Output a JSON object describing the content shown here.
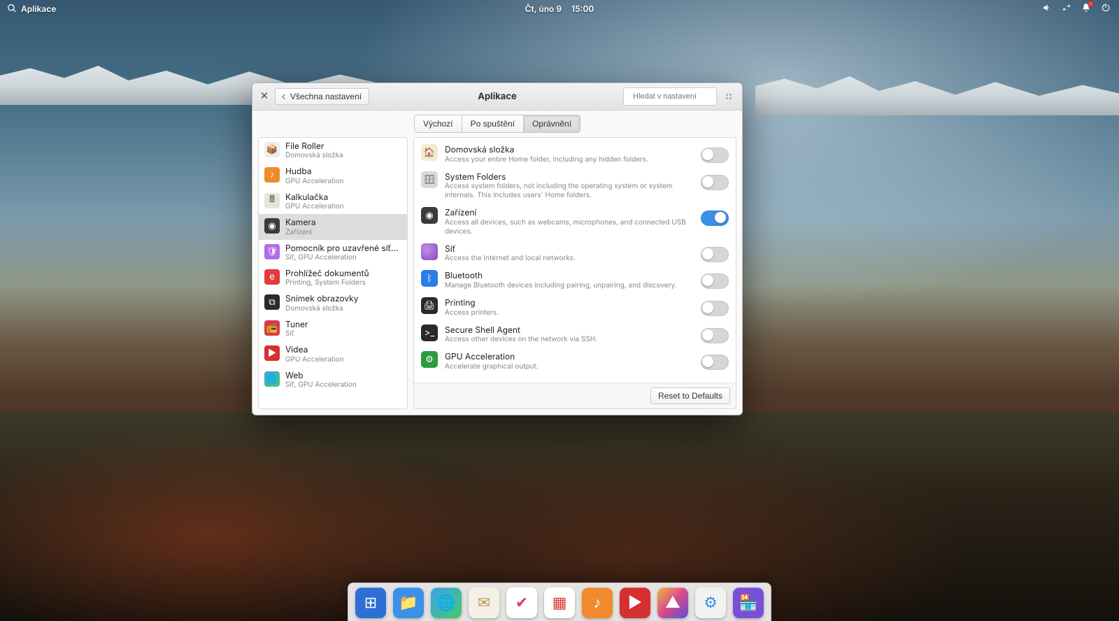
{
  "panel": {
    "apps_label": "Aplikace",
    "date": "Čt, úno  9",
    "time": "15:00"
  },
  "window": {
    "back_label": "Všechna nastavení",
    "title": "Aplikace",
    "search_placeholder": "Hledat v nastavení",
    "tabs": [
      "Výchozí",
      "Po spuštění",
      "Oprávnění"
    ],
    "active_tab": 2,
    "reset_label": "Reset to Defaults"
  },
  "apps": [
    {
      "name": "File Roller",
      "sub": "Domovská složka",
      "bg": "#ececec",
      "glyph": "📦",
      "fg": "#666"
    },
    {
      "name": "Hudba",
      "sub": "GPU Acceleration",
      "bg": "#f08a2c",
      "glyph": "♪"
    },
    {
      "name": "Kalkulačka",
      "sub": "GPU Acceleration",
      "bg": "#e8e3d8",
      "glyph": "🖩",
      "fg": "#555"
    },
    {
      "name": "Kamera",
      "sub": "Zařízení",
      "bg": "#3b3b3b",
      "glyph": "◉",
      "selected": true
    },
    {
      "name": "Pomocník pro uzavřené síťové p…",
      "sub": "Síť, GPU Acceleration",
      "bg": "#b06ce8",
      "glyph": "🛡"
    },
    {
      "name": "Prohlížeč dokumentů",
      "sub": "Printing, System Folders",
      "bg": "#e23b3b",
      "glyph": "e"
    },
    {
      "name": "Snímek obrazovky",
      "sub": "Domovská složka",
      "bg": "#2a2a2a",
      "glyph": "⧉"
    },
    {
      "name": "Tuner",
      "sub": "Síť",
      "bg": "#d63a4d",
      "glyph": "📻"
    },
    {
      "name": "Videa",
      "sub": "GPU Acceleration",
      "bg": "#d62f2f",
      "glyph": "▶"
    },
    {
      "name": "Web",
      "sub": "Síť, GPU Acceleration",
      "bg": "linear-gradient(135deg,#3ea0e8,#47c96b)",
      "glyph": "🌐"
    }
  ],
  "permissions": [
    {
      "title": "Domovská složka",
      "desc": "Access your entire Home folder, including any hidden folders.",
      "on": false,
      "bg": "#f2e9d6",
      "glyph": "🏠",
      "fg": "#a8894a"
    },
    {
      "title": "System Folders",
      "desc": "Access system folders, not including the operating system or system internals. This includes users' Home folders.",
      "on": false,
      "bg": "#d9d9d9",
      "glyph": "🗄",
      "fg": "#555"
    },
    {
      "title": "Zařízení",
      "desc": "Access all devices, such as webcams, microphones, and connected USB devices.",
      "on": true,
      "bg": "#3b3b3b",
      "glyph": "◉"
    },
    {
      "title": "Síť",
      "desc": "Access the Internet and local networks.",
      "on": false,
      "bg": "radial-gradient(circle at 35% 35%,#c98be8,#7a4fb8)",
      "glyph": ""
    },
    {
      "title": "Bluetooth",
      "desc": "Manage Bluetooth devices including pairing, unpairing, and discovery.",
      "on": false,
      "bg": "#2d7de8",
      "glyph": "ᛒ"
    },
    {
      "title": "Printing",
      "desc": "Access printers.",
      "on": false,
      "bg": "#2a2a2a",
      "glyph": "🖨"
    },
    {
      "title": "Secure Shell Agent",
      "desc": "Access other devices on the network via SSH.",
      "on": false,
      "bg": "#2a2a2a",
      "glyph": ">_"
    },
    {
      "title": "GPU Acceleration",
      "desc": "Accelerate graphical output.",
      "on": false,
      "bg": "#2e9a3f",
      "glyph": "⚙"
    }
  ],
  "dock": [
    {
      "name": "multitasking",
      "bg": "#2d6fd4",
      "glyph": "⊞"
    },
    {
      "name": "files",
      "bg": "#3a91e8",
      "glyph": "📁"
    },
    {
      "name": "web",
      "bg": "linear-gradient(135deg,#3ea0e8,#47c96b)",
      "glyph": "🌐"
    },
    {
      "name": "mail",
      "bg": "#f5f0e6",
      "glyph": "✉",
      "fg": "#b89a4a"
    },
    {
      "name": "tasks",
      "bg": "#fff",
      "glyph": "✔",
      "fg": "#d83a7a"
    },
    {
      "name": "calendar",
      "bg": "#fff",
      "glyph": "▦",
      "fg": "#d63a3a"
    },
    {
      "name": "music",
      "bg": "#f08a2c",
      "glyph": "♪"
    },
    {
      "name": "videos",
      "bg": "#d62f2f",
      "glyph": "▶"
    },
    {
      "name": "photos",
      "bg": "linear-gradient(135deg,#f0b83a,#d84a8a,#5a4fd8)",
      "glyph": "▲"
    },
    {
      "name": "settings",
      "bg": "#f2f2f2",
      "glyph": "⚙",
      "fg": "#3a8fe8"
    },
    {
      "name": "appcenter",
      "bg": "#7a4fd8",
      "glyph": "🏪"
    }
  ]
}
